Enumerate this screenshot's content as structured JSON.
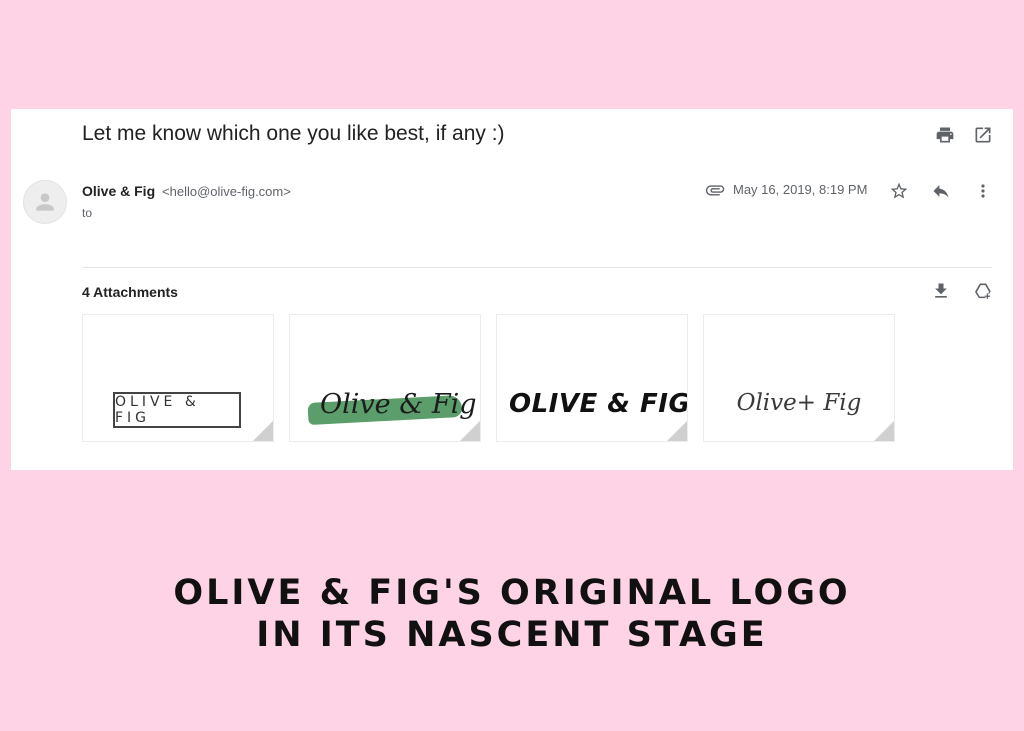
{
  "email": {
    "subject": "Let me know which one you like best, if any :)",
    "sender_name": "Olive & Fig",
    "sender_email": "<hello@olive-fig.com>",
    "to_label": "to",
    "date": "May 16, 2019, 8:19 PM"
  },
  "attachments": {
    "header": "4 Attachments",
    "items": [
      {
        "logo_text": "OLIVE & FIG"
      },
      {
        "logo_text": "Olive & Fig",
        "brush_color": "#5b9e6b"
      },
      {
        "logo_text": "OLIVE & FIG"
      },
      {
        "logo_text": "Olive+ Fig"
      }
    ]
  },
  "icons": {
    "header": [
      "print-icon",
      "open-in-new-window-icon"
    ],
    "message": [
      "attachment-clip-icon",
      "star-icon",
      "reply-icon",
      "more-vertical-icon"
    ],
    "attachments": [
      "download-all-icon",
      "add-to-drive-icon"
    ]
  },
  "caption": {
    "line1": "OLIVE & FIG'S ORIGINAL LOGO",
    "line2": "IN ITS NASCENT STAGE"
  },
  "colors": {
    "background": "#fdd3e5",
    "card": "#ffffff",
    "icon": "#5f6368"
  }
}
